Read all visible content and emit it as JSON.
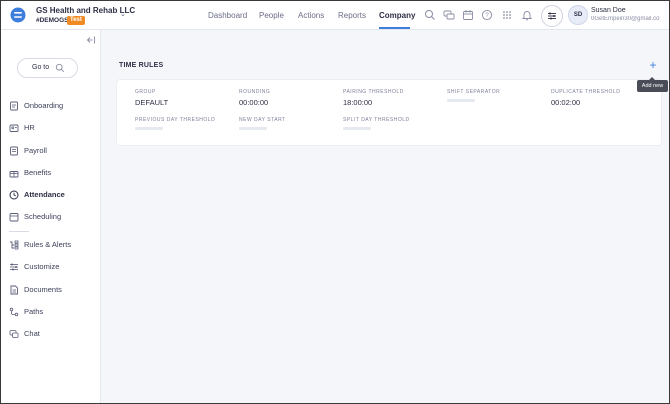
{
  "header": {
    "company_name": "GS Health and Rehab LLC",
    "company_code": "#DEMOGS",
    "test_badge": "Test",
    "nav": [
      {
        "label": "Dashboard"
      },
      {
        "label": "People"
      },
      {
        "label": "Actions"
      },
      {
        "label": "Reports"
      },
      {
        "label": "Company"
      }
    ],
    "active_nav": "Company",
    "user": {
      "initials": "SD",
      "name": "Susan Doe",
      "email": "0GetEmpein30@gmail.co"
    }
  },
  "sidebar": {
    "goto_label": "Go to",
    "items": [
      {
        "label": "Onboarding",
        "icon": "onboarding-icon"
      },
      {
        "label": "HR",
        "icon": "hr-icon"
      },
      {
        "label": "Payroll",
        "icon": "payroll-icon"
      },
      {
        "label": "Benefits",
        "icon": "benefits-icon"
      },
      {
        "label": "Attendance",
        "icon": "attendance-icon"
      },
      {
        "label": "Scheduling",
        "icon": "scheduling-icon"
      },
      {
        "label": "Rules & Alerts",
        "icon": "rules-icon"
      },
      {
        "label": "Customize",
        "icon": "customize-icon"
      },
      {
        "label": "Documents",
        "icon": "documents-icon"
      },
      {
        "label": "Paths",
        "icon": "paths-icon"
      },
      {
        "label": "Chat",
        "icon": "chat-icon"
      }
    ],
    "active_item": "Attendance"
  },
  "main": {
    "section_title": "TIME RULES",
    "add_tooltip": "Add new",
    "fields": [
      {
        "label": "GROUP",
        "value": "DEFAULT"
      },
      {
        "label": "ROUNDING",
        "value": "00:00:00"
      },
      {
        "label": "PAIRING THRESHOLD",
        "value": "18:00:00"
      },
      {
        "label": "SHIFT SEPARATOR",
        "value": ""
      },
      {
        "label": "DUPLICATE THRESHOLD",
        "value": "00:02:00"
      },
      {
        "label": "PREVIOUS DAY THRESHOLD",
        "value": ""
      },
      {
        "label": "NEW DAY START",
        "value": ""
      },
      {
        "label": "SPLIT DAY THRESHOLD",
        "value": ""
      }
    ]
  },
  "colors": {
    "accent": "#3d7ddb",
    "badge": "#f08a24",
    "background": "#f5f6fa"
  }
}
